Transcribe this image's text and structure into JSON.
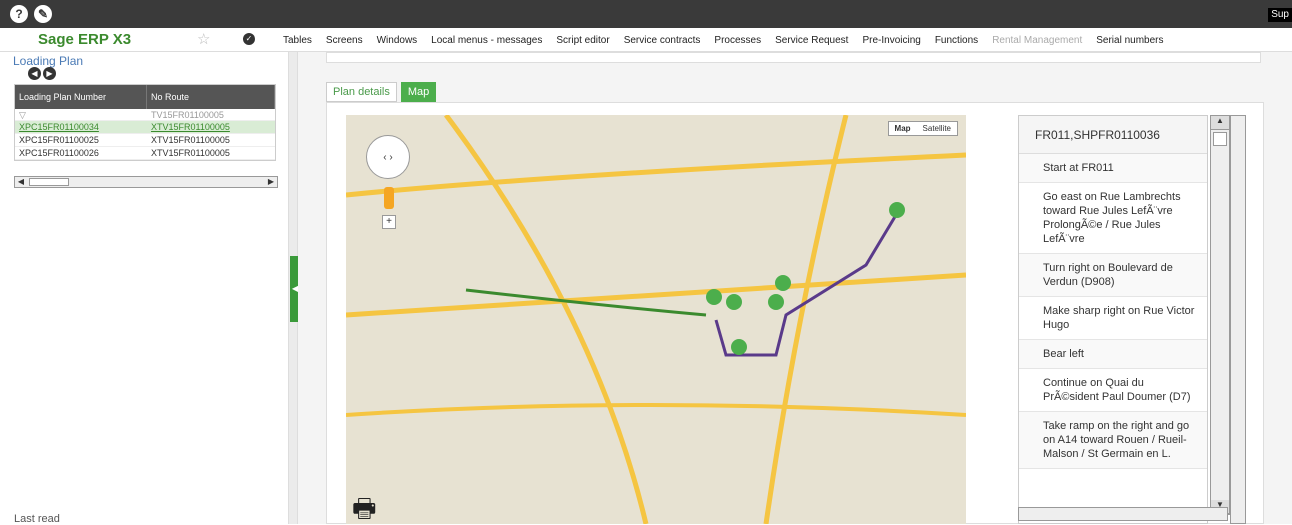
{
  "topbar": {
    "sup_label": "Sup",
    "help_icon": "question-icon",
    "edit_icon": "pencil-icon"
  },
  "menubar": {
    "logo": "Sage ERP X3",
    "items": [
      "Tables",
      "Screens",
      "Windows",
      "Local menus - messages",
      "Script editor",
      "Service contracts",
      "Processes",
      "Service Request",
      "Pre-Invoicing",
      "Functions",
      "Rental Management",
      "Serial numbers"
    ]
  },
  "left": {
    "title": "Loading Plan",
    "columns": [
      "Loading Plan Number",
      "No Route"
    ],
    "filter_value": "TV15FR01100005",
    "rows": [
      [
        "XPC15FR01100034",
        "XTV15FR01100005"
      ],
      [
        "XPC15FR01100025",
        "XTV15FR01100005"
      ],
      [
        "XPC15FR01100026",
        "XTV15FR01100005"
      ]
    ],
    "last_read": "Last read"
  },
  "tabs": {
    "plan_details": "Plan details",
    "map": "Map"
  },
  "map": {
    "map_btn": "Map",
    "satellite_btn": "Satellite"
  },
  "directions": {
    "header": "FR011,SHPFR0110036",
    "steps": [
      "Start at FR011",
      "Go east on Rue Lambrechts toward Rue Jules LefÃ¨vre ProlongÃ©e / Rue Jules LefÃ¨vre",
      "Turn right on Boulevard de Verdun (D908)",
      "Make sharp right on Rue Victor Hugo",
      "Bear left",
      "Continue on Quai du PrÃ©sident Paul Doumer (D7)",
      "Take ramp on the right and go on A14 toward Rouen / Rueil-Malson / St Germain en L."
    ]
  },
  "colors": {
    "accent": "#4cae4c",
    "topbar": "#3a3a3a",
    "route": "#5a3a8a"
  }
}
